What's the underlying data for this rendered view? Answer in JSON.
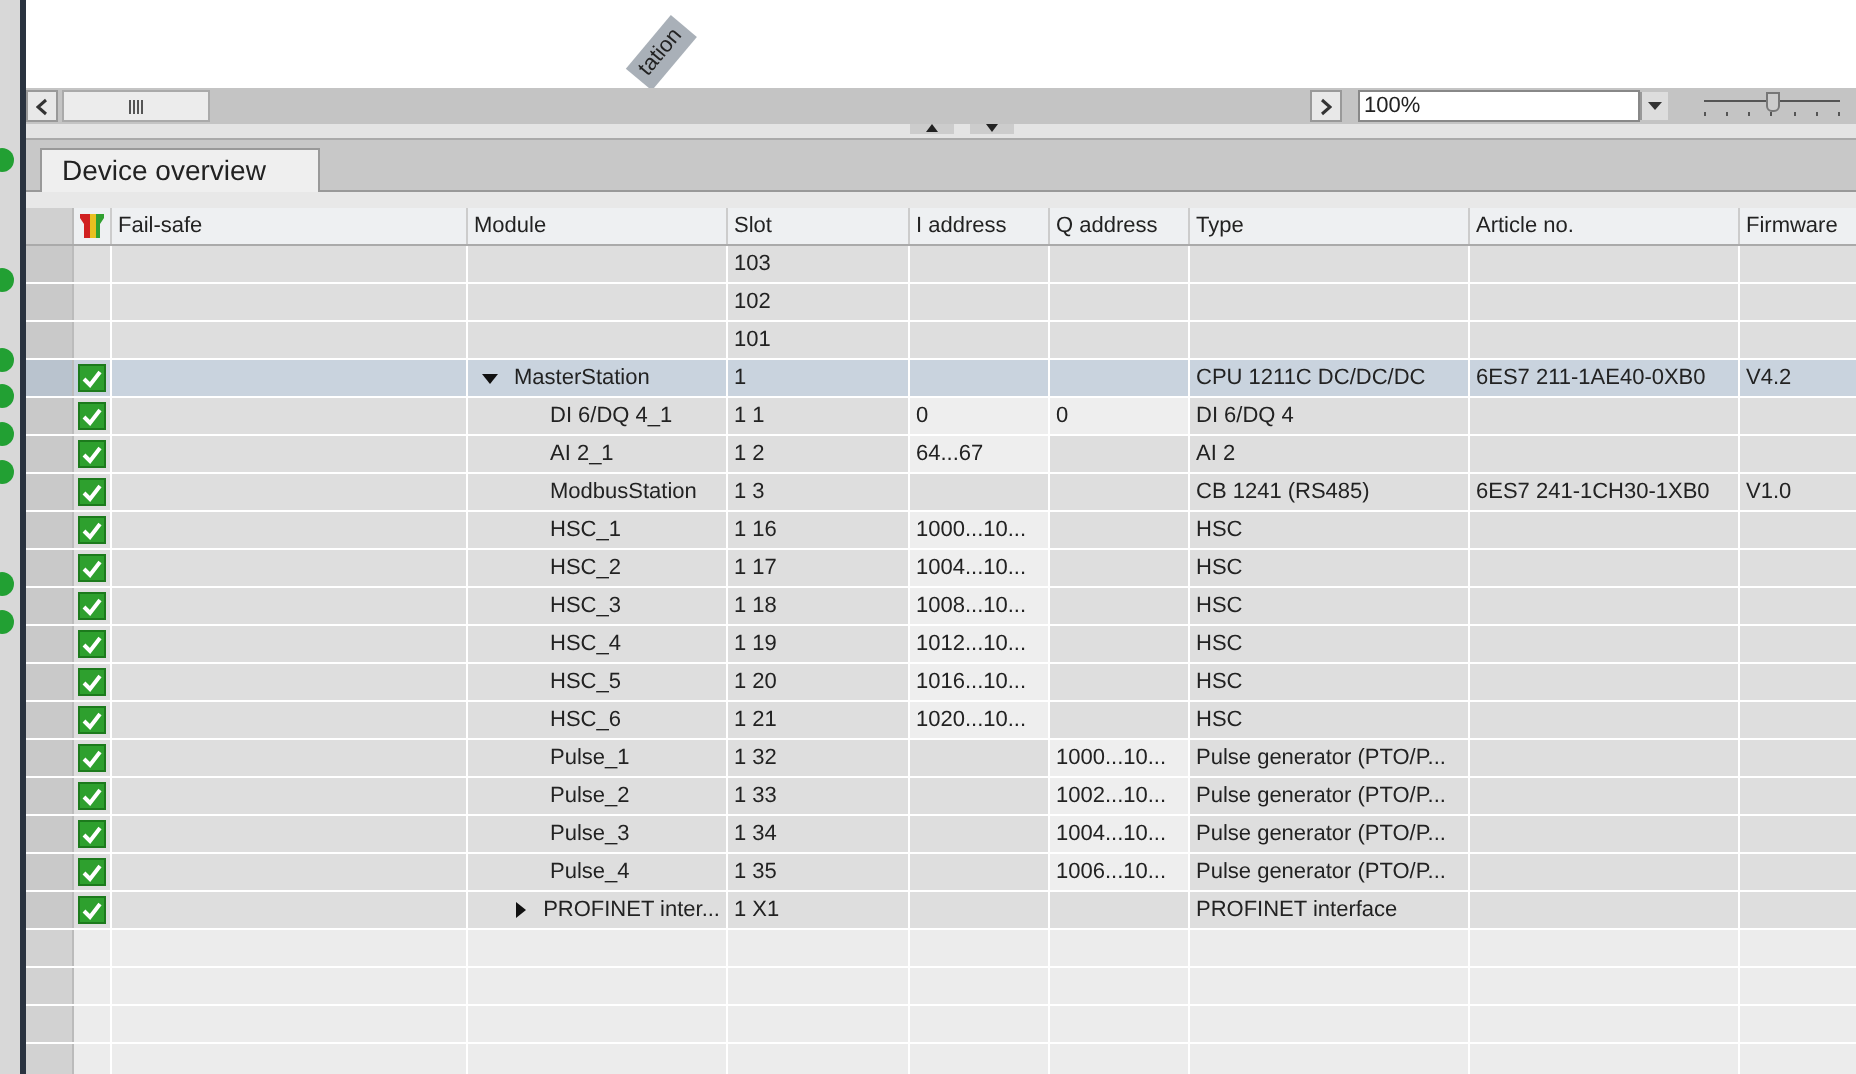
{
  "canvas": {
    "device_label": "tation"
  },
  "toolbar": {
    "zoom": {
      "value": "100%"
    },
    "zoom_slider": {
      "level": 0.5
    }
  },
  "tabs": [
    {
      "label": "Device overview",
      "selected": true
    }
  ],
  "table": {
    "columns": [
      "Fail-safe",
      "Module",
      "Slot",
      "I address",
      "Q address",
      "Type",
      "Article no.",
      "Firmware"
    ],
    "rows": [
      {
        "kind": "slot",
        "selected": false,
        "slot": "103"
      },
      {
        "kind": "slot",
        "selected": false,
        "slot": "102"
      },
      {
        "kind": "slot",
        "selected": false,
        "slot": "101"
      },
      {
        "kind": "module",
        "checked": true,
        "selected": true,
        "expanded": true,
        "module": "MasterStation",
        "slot": "1",
        "type": "CPU 1211C DC/DC/DC",
        "article": "6ES7 211-1AE40-0XB0",
        "firmware": "V4.2",
        "children": [
          {
            "kind": "module",
            "checked": true,
            "selected": false,
            "module": "DI 6/DQ 4_1",
            "slot": "1 1",
            "i_address": "0",
            "q_address": "0",
            "type": "DI 6/DQ 4"
          },
          {
            "kind": "module",
            "checked": true,
            "selected": false,
            "module": "AI 2_1",
            "slot": "1 2",
            "i_address": "64...67",
            "type": "AI 2"
          },
          {
            "kind": "module",
            "checked": true,
            "selected": false,
            "module": "ModbusStation",
            "slot": "1 3",
            "type": "CB 1241 (RS485)",
            "article": "6ES7 241-1CH30-1XB0",
            "firmware": "V1.0"
          },
          {
            "kind": "module",
            "checked": true,
            "selected": false,
            "module": "HSC_1",
            "slot": "1 16",
            "i_address": "1000...10...",
            "type": "HSC"
          },
          {
            "kind": "module",
            "checked": true,
            "selected": false,
            "module": "HSC_2",
            "slot": "1 17",
            "i_address": "1004...10...",
            "type": "HSC"
          },
          {
            "kind": "module",
            "checked": true,
            "selected": false,
            "module": "HSC_3",
            "slot": "1 18",
            "i_address": "1008...10...",
            "type": "HSC"
          },
          {
            "kind": "module",
            "checked": true,
            "selected": false,
            "module": "HSC_4",
            "slot": "1 19",
            "i_address": "1012...10...",
            "type": "HSC"
          },
          {
            "kind": "module",
            "checked": true,
            "selected": false,
            "module": "HSC_5",
            "slot": "1 20",
            "i_address": "1016...10...",
            "type": "HSC"
          },
          {
            "kind": "module",
            "checked": true,
            "selected": false,
            "module": "HSC_6",
            "slot": "1 21",
            "i_address": "1020...10...",
            "type": "HSC"
          },
          {
            "kind": "module",
            "checked": true,
            "selected": false,
            "module": "Pulse_1",
            "slot": "1 32",
            "q_address": "1000...10...",
            "type": "Pulse generator (PTO/P..."
          },
          {
            "kind": "module",
            "checked": true,
            "selected": false,
            "module": "Pulse_2",
            "slot": "1 33",
            "q_address": "1002...10...",
            "type": "Pulse generator (PTO/P..."
          },
          {
            "kind": "module",
            "checked": true,
            "selected": false,
            "module": "Pulse_3",
            "slot": "1 34",
            "q_address": "1004...10...",
            "type": "Pulse generator (PTO/P..."
          },
          {
            "kind": "module",
            "checked": true,
            "selected": false,
            "module": "Pulse_4",
            "slot": "1 35",
            "q_address": "1006...10...",
            "type": "Pulse generator (PTO/P..."
          },
          {
            "kind": "module",
            "checked": true,
            "selected": false,
            "expanded": false,
            "module": "PROFINET inter...",
            "slot": "1 X1",
            "type": "PROFINET interface"
          }
        ]
      }
    ]
  }
}
